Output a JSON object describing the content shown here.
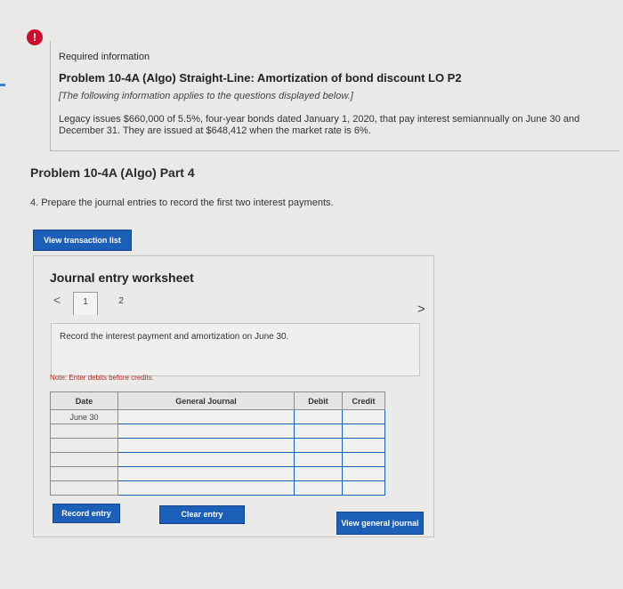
{
  "alert": {
    "icon": "!"
  },
  "info": {
    "required": "Required information",
    "title": "Problem 10-4A (Algo) Straight-Line: Amortization of bond discount LO P2",
    "note": "[The following information applies to the questions displayed below.]",
    "description": "Legacy issues $660,000 of 5.5%, four-year bonds dated January 1, 2020, that pay interest semiannually on June 30 and December 31. They are issued at $648,412 when the market rate is 6%."
  },
  "part": {
    "title": "Problem 10-4A (Algo) Part 4",
    "instruction": "4. Prepare the journal entries to record the first two interest payments."
  },
  "buttons": {
    "view_transaction_list": "View transaction list",
    "record_entry": "Record entry",
    "clear_entry": "Clear entry",
    "view_general_journal": "View general journal"
  },
  "worksheet": {
    "title": "Journal entry worksheet",
    "prev": "<",
    "next": ">",
    "pages": [
      "1",
      "2"
    ],
    "description": "Record the interest payment and amortization on June 30.",
    "note": "Note: Enter debits before credits.",
    "columns": {
      "date": "Date",
      "account": "General Journal",
      "debit": "Debit",
      "credit": "Credit"
    },
    "rows": [
      {
        "date": "June 30",
        "account": "",
        "debit": "",
        "credit": ""
      },
      {
        "date": "",
        "account": "",
        "debit": "",
        "credit": ""
      },
      {
        "date": "",
        "account": "",
        "debit": "",
        "credit": ""
      },
      {
        "date": "",
        "account": "",
        "debit": "",
        "credit": ""
      },
      {
        "date": "",
        "account": "",
        "debit": "",
        "credit": ""
      },
      {
        "date": "",
        "account": "",
        "debit": "",
        "credit": ""
      }
    ]
  },
  "colors": {
    "primary_button": "#1c5fb8",
    "alert": "#c8102e",
    "note": "#b0302a"
  }
}
